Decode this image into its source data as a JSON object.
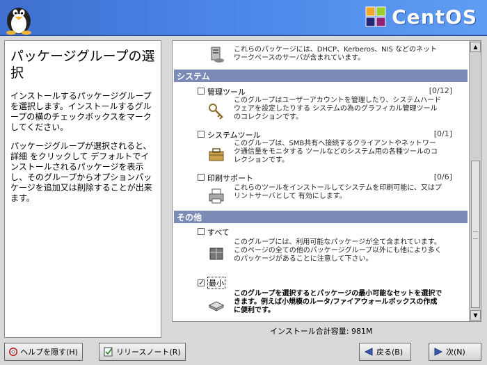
{
  "banner": {
    "brand": "CentOS"
  },
  "help": {
    "title": "パッケージグループの選択",
    "para1": "インストールするパッケージグループを選択します。インストールするグループの横のチェックボックスをマークしてください。",
    "para2": "パッケージグループが選択されると、詳細 をクリックして デフォルトでインストールされるパッケージを表示し、そのグループからオプションパッケージを追加又は削除することが出来ます。"
  },
  "packages": {
    "top_item_desc": "これらのパッケージには、DHCP、Kerberos、NIS などのネットワークベースのサーバが含まれています。",
    "groups": [
      {
        "header": "システム",
        "items": [
          {
            "name": "管理ツール",
            "count": "[0/12]",
            "checked": false,
            "desc": "このグループはユーザーアカウントを管理したり、システムハードウェアを設定したりする システムの為のグラフィカル管理ツールのコレクションです。"
          },
          {
            "name": "システムツール",
            "count": "[0/1]",
            "checked": false,
            "desc": "このグループは、SMB共有へ接続するクライアントやネットワーク通信量をモニタする ツールなどのシステム用の各種ツールのコレクションです。"
          },
          {
            "name": "印刷サポート",
            "count": "[0/6]",
            "checked": false,
            "desc": "これらのツールをインストールしてシステムを印刷可能に、又はプリントサーバとして 有効にします。"
          }
        ]
      },
      {
        "header": "その他",
        "items": [
          {
            "name": "すべて",
            "count": "",
            "checked": false,
            "desc": "このグループには、利用可能なパッケージが全て含まれています。このページの全ての他のパッケージグループ以外にも他により多くのパッケージがあることに注意して下さい。"
          },
          {
            "name": "最小",
            "count": "",
            "checked": true,
            "desc": "このグループを選択するとパッケージの最小可能なセットを選択できます。例えば小規模のルータ/ファイアウォールボックスの作成に便利です。"
          }
        ]
      }
    ]
  },
  "install_size": "インストール合計容量:  981M",
  "buttons": {
    "hide_help": "ヘルプを隠す(H)",
    "release_notes": "リリースノート(R)",
    "back": "戻る(B)",
    "next": "次(N)"
  }
}
